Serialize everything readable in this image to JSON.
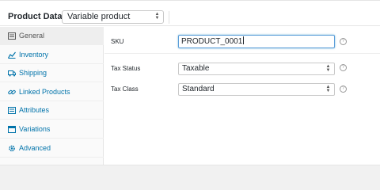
{
  "header": {
    "title": "Product Data —",
    "product_type": "Variable product"
  },
  "sidebar": {
    "items": [
      {
        "label": "General",
        "icon": "wrench-icon"
      },
      {
        "label": "Inventory",
        "icon": "inventory-icon"
      },
      {
        "label": "Shipping",
        "icon": "truck-icon"
      },
      {
        "label": "Linked Products",
        "icon": "link-icon"
      },
      {
        "label": "Attributes",
        "icon": "list-icon"
      },
      {
        "label": "Variations",
        "icon": "grid-icon"
      },
      {
        "label": "Advanced",
        "icon": "gear-icon"
      }
    ]
  },
  "general": {
    "sku": {
      "label": "SKU",
      "value": "PRODUCT_0001"
    },
    "tax_status": {
      "label": "Tax Status",
      "value": "Taxable"
    },
    "tax_class": {
      "label": "Tax Class",
      "value": "Standard"
    }
  },
  "colors": {
    "link": "#0073aa",
    "active_tab": "#eeeeee",
    "focus_border": "#5b9dd9"
  }
}
